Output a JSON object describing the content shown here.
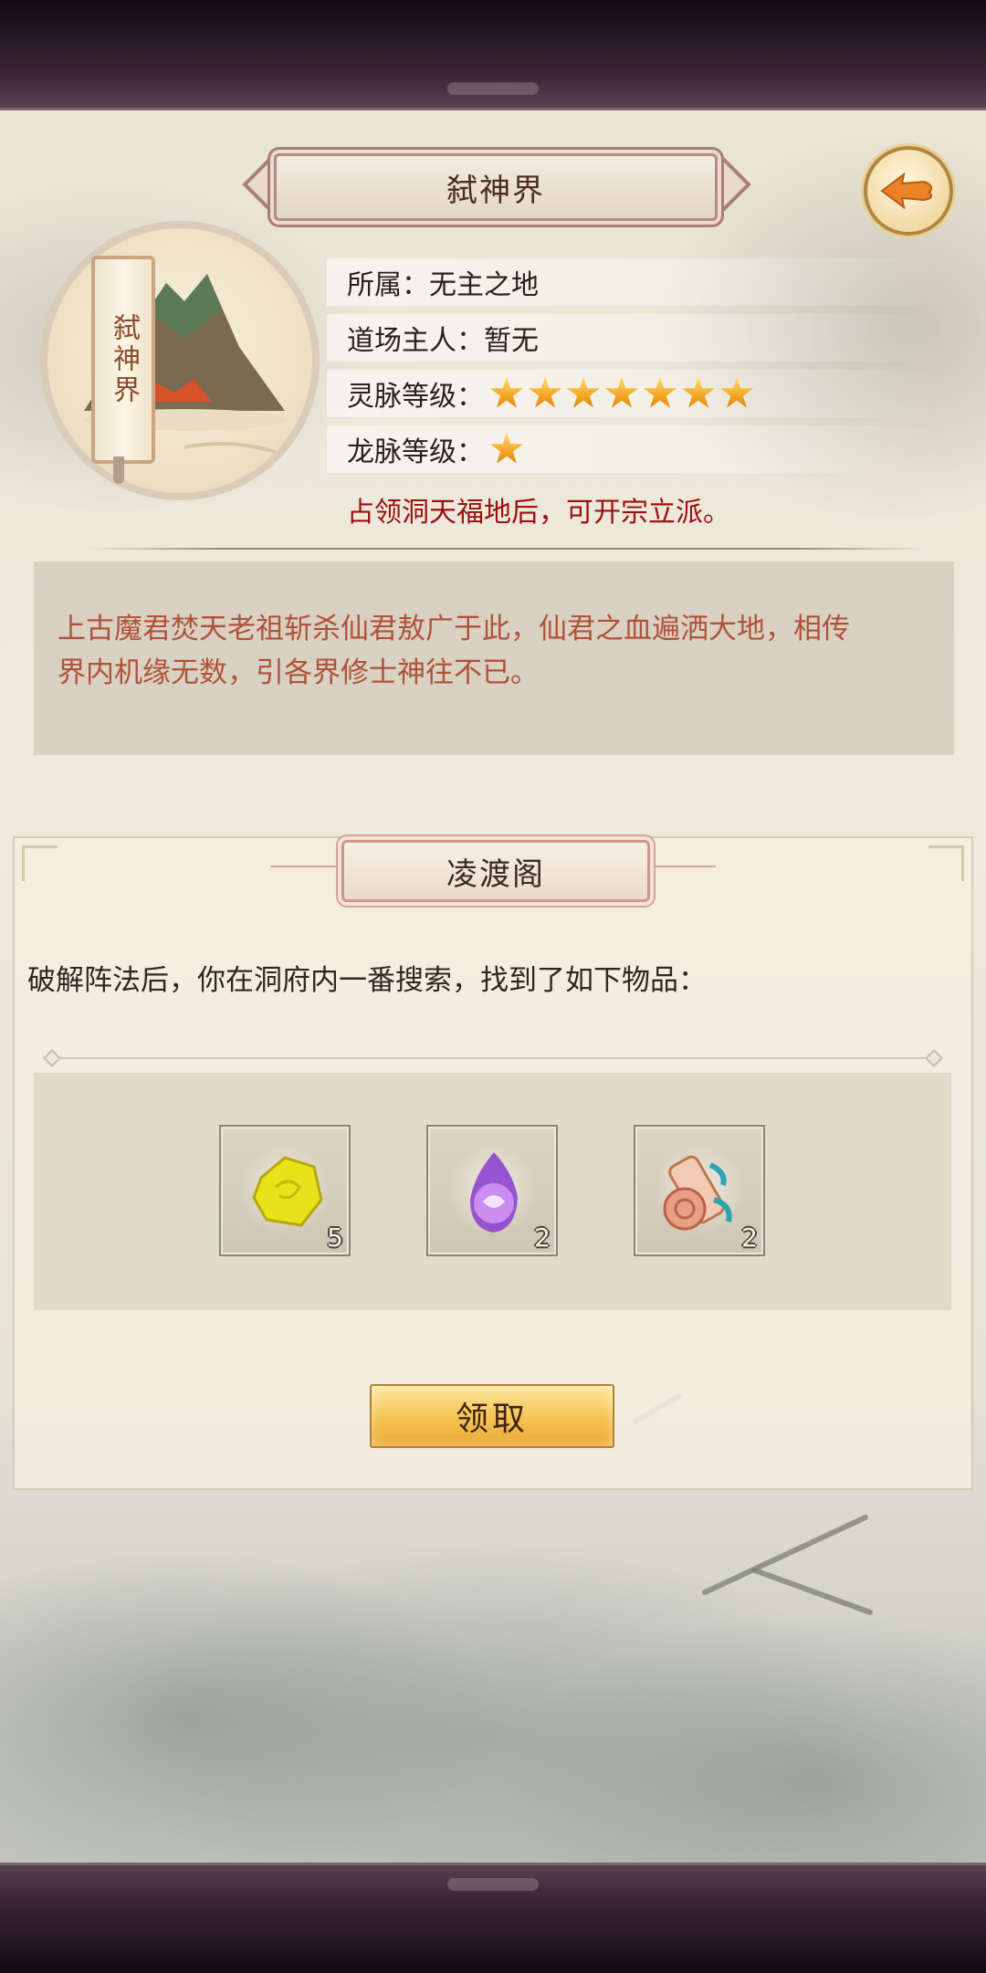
{
  "header": {
    "title": "弑神界",
    "back_icon": "fish-arrow-back-icon"
  },
  "emblem": {
    "banner_text": "弑神界"
  },
  "info": {
    "affiliation": "所属：无主之地",
    "owner": "道场主人：暂无",
    "spirit_vein_label": "灵脉等级：",
    "spirit_vein_level": 7,
    "dragon_vein_label": "龙脉等级：",
    "dragon_vein_level": 1,
    "hint": "占领洞天福地后，可开宗立派。"
  },
  "description": {
    "line1": "上古魔君焚天老祖斩杀仙君敖广于此，仙君之血遍洒大地，相传",
    "line2": "界内机缘无数，引各界修士神往不已。"
  },
  "loot": {
    "section_title": "凌渡阁",
    "intro": "破解阵法后，你在洞府内一番搜索，找到了如下物品：",
    "items": [
      {
        "icon": "yellow-ore-icon",
        "count": "5"
      },
      {
        "icon": "purple-spirit-orb-icon",
        "count": "2"
      },
      {
        "icon": "scroll-icon",
        "count": "2"
      }
    ],
    "claim_label": "领取"
  },
  "colors": {
    "title_text": "#4a2e25",
    "hint_red": "#9b1010",
    "description_text": "#b0523a",
    "button_gold": "#f6c656",
    "star": "#f3a11e"
  }
}
